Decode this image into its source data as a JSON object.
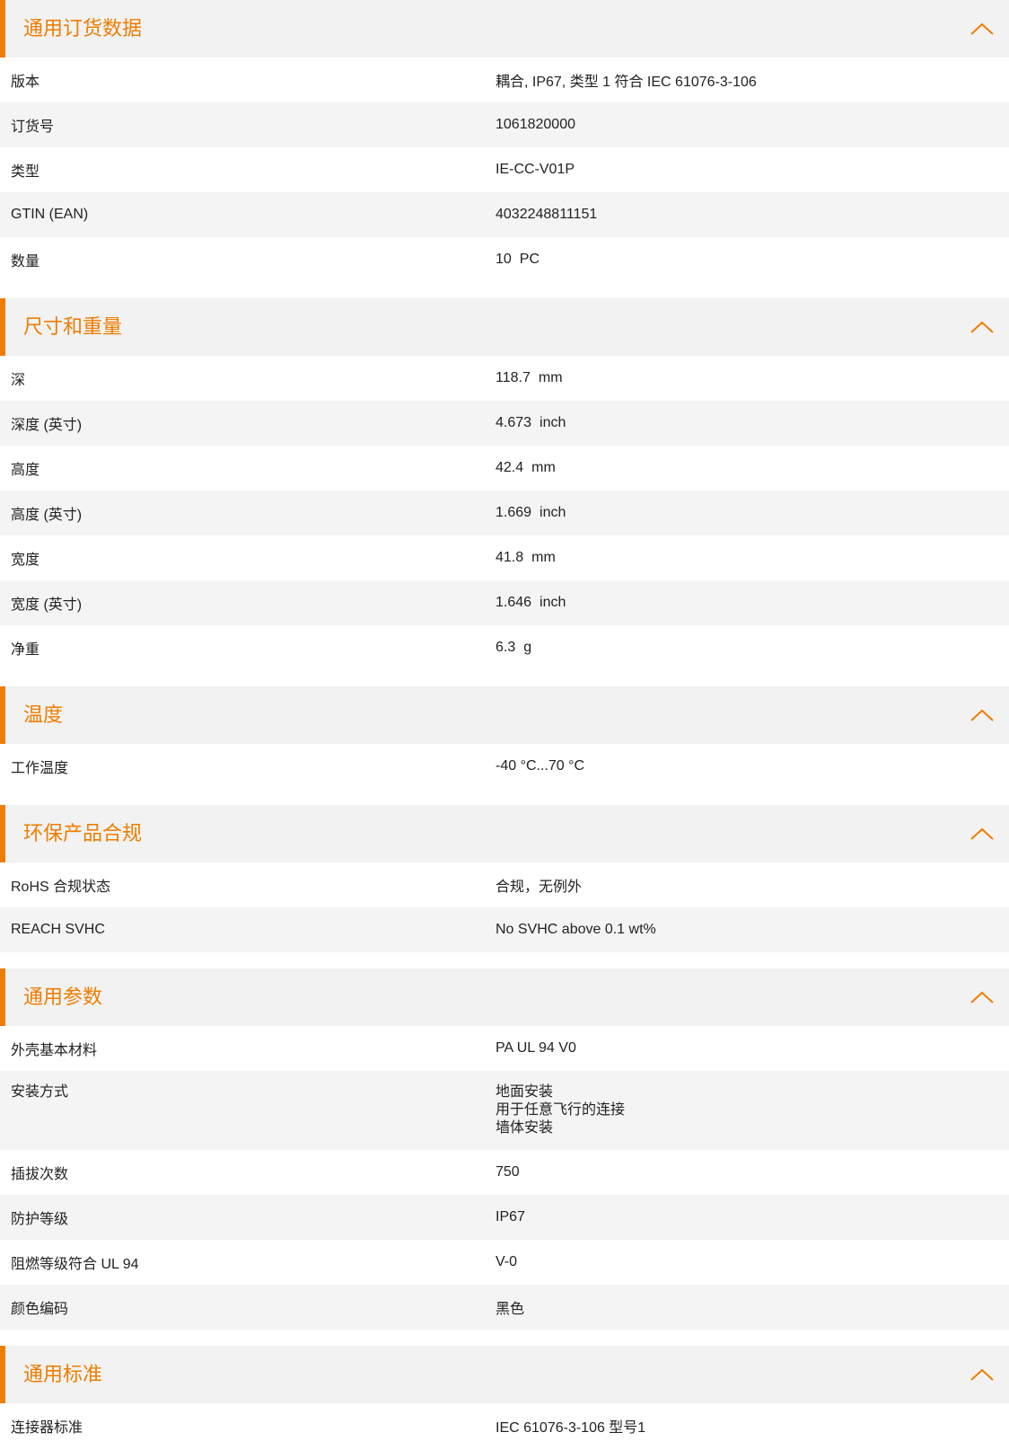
{
  "colors": {
    "accent": "#ee7d00",
    "header_bg": "#f2f2f2",
    "row_alt_bg": "#f4f4f4",
    "text": "#222222"
  },
  "icons": {
    "collapse": "chevron-up-icon"
  },
  "sections": [
    {
      "title": "通用订货数据",
      "rows": [
        {
          "label": "版本",
          "value": "耦合, IP67, 类型 1 符合 IEC 61076-3-106"
        },
        {
          "label": "订货号",
          "value": "1061820000"
        },
        {
          "label": "类型",
          "value": "IE-CC-V01P"
        },
        {
          "label": "GTIN (EAN)",
          "value": "4032248811151"
        },
        {
          "label": "数量",
          "value": "10",
          "unit": "PC"
        }
      ]
    },
    {
      "title": "尺寸和重量",
      "rows": [
        {
          "label": "深",
          "value": "118.7",
          "unit": "mm"
        },
        {
          "label": "深度 (英寸)",
          "value": "4.673",
          "unit": "inch"
        },
        {
          "label": "高度",
          "value": "42.4",
          "unit": "mm"
        },
        {
          "label": "高度 (英寸)",
          "value": "1.669",
          "unit": "inch"
        },
        {
          "label": "宽度",
          "value": "41.8",
          "unit": "mm"
        },
        {
          "label": "宽度 (英寸)",
          "value": "1.646",
          "unit": "inch"
        },
        {
          "label": "净重",
          "value": "6.3",
          "unit": "g"
        }
      ]
    },
    {
      "title": "温度",
      "rows": [
        {
          "label": "工作温度",
          "value": "-40 °C...70 °C"
        }
      ]
    },
    {
      "title": "环保产品合规",
      "rows": [
        {
          "label": "RoHS 合规状态",
          "value": "合规，无例外"
        },
        {
          "label": "REACH SVHC",
          "value": "No SVHC above 0.1 wt%"
        }
      ]
    },
    {
      "title": "通用参数",
      "rows": [
        {
          "label": "外壳基本材料",
          "value": "PA UL 94 V0"
        },
        {
          "label": "安装方式",
          "lines": [
            "地面安装",
            "用于任意飞行的连接",
            "墙体安装"
          ]
        },
        {
          "label": "插拔次数",
          "value": "750"
        },
        {
          "label": "防护等级",
          "value": "IP67"
        },
        {
          "label": "阻燃等级符合 UL 94",
          "value": "V-0"
        },
        {
          "label": "颜色编码",
          "value": "黑色"
        }
      ]
    },
    {
      "title": "通用标准",
      "rows": [
        {
          "label": "连接器标准",
          "value": "IEC 61076-3-106 型号1"
        }
      ]
    }
  ]
}
